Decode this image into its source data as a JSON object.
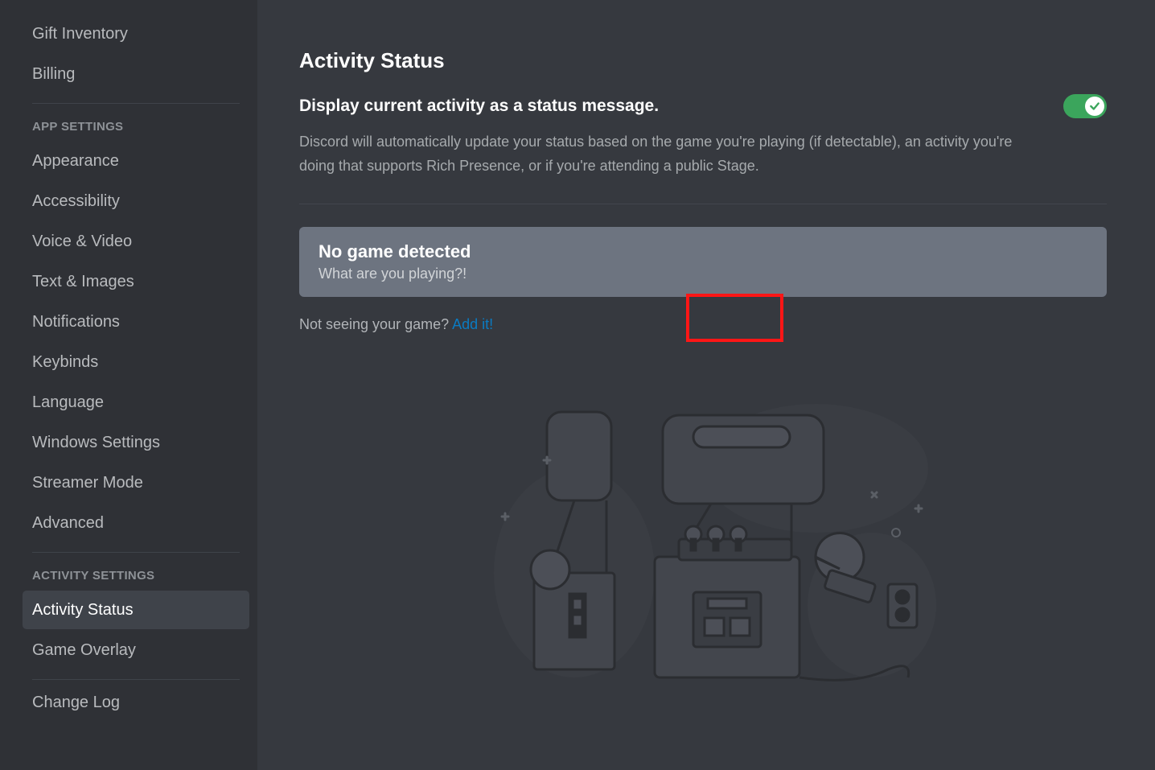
{
  "sidebar": {
    "top_items": [
      "Gift Inventory",
      "Billing"
    ],
    "app_header": "APP SETTINGS",
    "app_items": [
      "Appearance",
      "Accessibility",
      "Voice & Video",
      "Text & Images",
      "Notifications",
      "Keybinds",
      "Language",
      "Windows Settings",
      "Streamer Mode",
      "Advanced"
    ],
    "activity_header": "ACTIVITY SETTINGS",
    "activity_items": [
      "Activity Status",
      "Game Overlay"
    ],
    "active_item": "Activity Status",
    "bottom_items": [
      "Change Log"
    ]
  },
  "main": {
    "title": "Activity Status",
    "toggle_label": "Display current activity as a status message.",
    "toggle_on": true,
    "description": "Discord will automatically update your status based on the game you're playing (if detectable), an activity you're doing that supports Rich Presence, or if you're attending a public Stage.",
    "card_title": "No game detected",
    "card_sub": "What are you playing?!",
    "not_seeing": "Not seeing your game? ",
    "add_it": "Add it!"
  },
  "colors": {
    "toggle_on": "#3ba55c",
    "link": "#0a7bc2",
    "highlight": "#ff1616"
  }
}
